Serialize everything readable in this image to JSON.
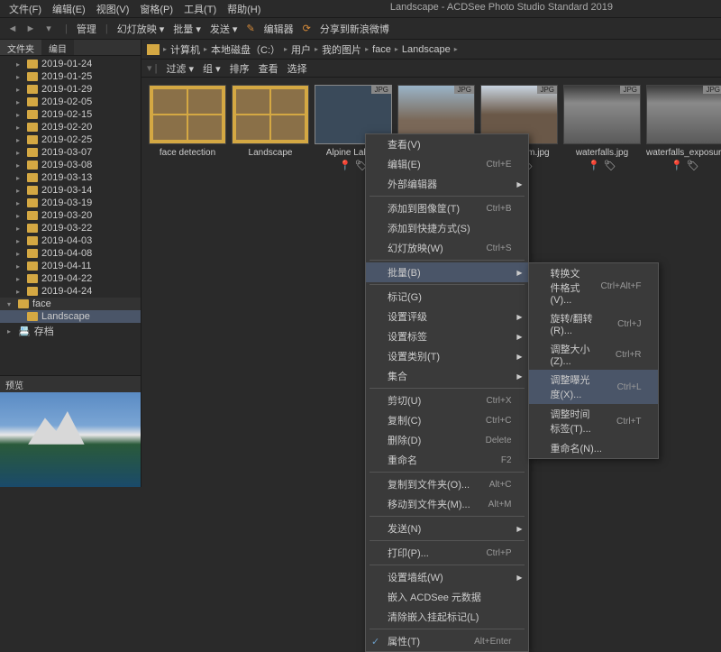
{
  "app_title": "Landscape - ACDSee Photo Studio Standard 2019",
  "menu": [
    "文件(F)",
    "编辑(E)",
    "视图(V)",
    "窗格(P)",
    "工具(T)",
    "帮助(H)"
  ],
  "toolbar": {
    "manage": "管理",
    "slideshow": "幻灯放映 ▾",
    "batch": "批量 ▾",
    "send": "发送 ▾",
    "editor": "编辑器",
    "share": "分享到新浪微博"
  },
  "left_tabs": {
    "files": "文件夹",
    "catalog": "编目"
  },
  "tree": [
    {
      "name": "2019-01-24"
    },
    {
      "name": "2019-01-25"
    },
    {
      "name": "2019-01-29"
    },
    {
      "name": "2019-02-05"
    },
    {
      "name": "2019-02-15"
    },
    {
      "name": "2019-02-20"
    },
    {
      "name": "2019-02-25"
    },
    {
      "name": "2019-03-07"
    },
    {
      "name": "2019-03-08"
    },
    {
      "name": "2019-03-13"
    },
    {
      "name": "2019-03-14"
    },
    {
      "name": "2019-03-19"
    },
    {
      "name": "2019-03-20"
    },
    {
      "name": "2019-03-22"
    },
    {
      "name": "2019-04-03"
    },
    {
      "name": "2019-04-08"
    },
    {
      "name": "2019-04-11"
    },
    {
      "name": "2019-04-22"
    },
    {
      "name": "2019-04-24"
    }
  ],
  "tree_face": "face",
  "tree_landscape": "Landscape",
  "tree_archive": "存档",
  "preview": "预览",
  "breadcrumb": [
    "计算机",
    "本地磁盘（C:）",
    "用户",
    "我的图片",
    "face",
    "Landscape"
  ],
  "filter": {
    "filter": "过滤 ▾",
    "group": "组 ▾",
    "sort": "排序",
    "view": "查看",
    "select": "选择"
  },
  "thumbs": [
    {
      "label": "face detection",
      "type": "folder"
    },
    {
      "label": "Landscape",
      "type": "folder"
    },
    {
      "label": "Alpine Lake...",
      "badge": "JPG",
      "sel": true
    },
    {
      "label": "",
      "badge": "JPG"
    },
    {
      "label": "Amsterdam.jpg",
      "badge": "JPG"
    },
    {
      "label": "waterfalls.jpg",
      "badge": "JPG"
    },
    {
      "label": "waterfalls_exposure.jpg",
      "badge": "JPG"
    }
  ],
  "ctx": [
    {
      "l": "查看(V)"
    },
    {
      "l": "编辑(E)",
      "s": "Ctrl+E"
    },
    {
      "l": "外部编辑器",
      "a": true
    },
    {
      "sep": true
    },
    {
      "l": "添加到图像筐(T)",
      "s": "Ctrl+B"
    },
    {
      "l": "添加到快捷方式(S)"
    },
    {
      "l": "幻灯放映(W)",
      "s": "Ctrl+S"
    },
    {
      "sep": true
    },
    {
      "l": "批量(B)",
      "a": true,
      "hov": true
    },
    {
      "sep": true
    },
    {
      "l": "标记(G)"
    },
    {
      "l": "设置评级",
      "a": true
    },
    {
      "l": "设置标签",
      "a": true
    },
    {
      "l": "设置类别(T)",
      "a": true
    },
    {
      "l": "集合",
      "a": true
    },
    {
      "sep": true
    },
    {
      "l": "剪切(U)",
      "s": "Ctrl+X"
    },
    {
      "l": "复制(C)",
      "s": "Ctrl+C"
    },
    {
      "l": "删除(D)",
      "s": "Delete"
    },
    {
      "l": "重命名",
      "s": "F2"
    },
    {
      "sep": true
    },
    {
      "l": "复制到文件夹(O)...",
      "s": "Alt+C"
    },
    {
      "l": "移动到文件夹(M)...",
      "s": "Alt+M"
    },
    {
      "sep": true
    },
    {
      "l": "发送(N)",
      "a": true
    },
    {
      "sep": true
    },
    {
      "l": "打印(P)...",
      "s": "Ctrl+P"
    },
    {
      "sep": true
    },
    {
      "l": "设置墙纸(W)",
      "a": true
    },
    {
      "l": "嵌入 ACDSee 元数据"
    },
    {
      "l": "清除嵌入挂起标记(L)"
    },
    {
      "sep": true
    },
    {
      "l": "属性(T)",
      "s": "Alt+Enter",
      "chk": true
    }
  ],
  "sub": [
    {
      "l": "转换文件格式(V)...",
      "s": "Ctrl+Alt+F"
    },
    {
      "l": "旋转/翻转(R)...",
      "s": "Ctrl+J"
    },
    {
      "l": "调整大小(Z)...",
      "s": "Ctrl+R"
    },
    {
      "l": "调整曝光度(X)...",
      "s": "Ctrl+L",
      "hov": true
    },
    {
      "l": "调整时间标签(T)...",
      "s": "Ctrl+T"
    },
    {
      "l": "重命名(N)..."
    }
  ]
}
